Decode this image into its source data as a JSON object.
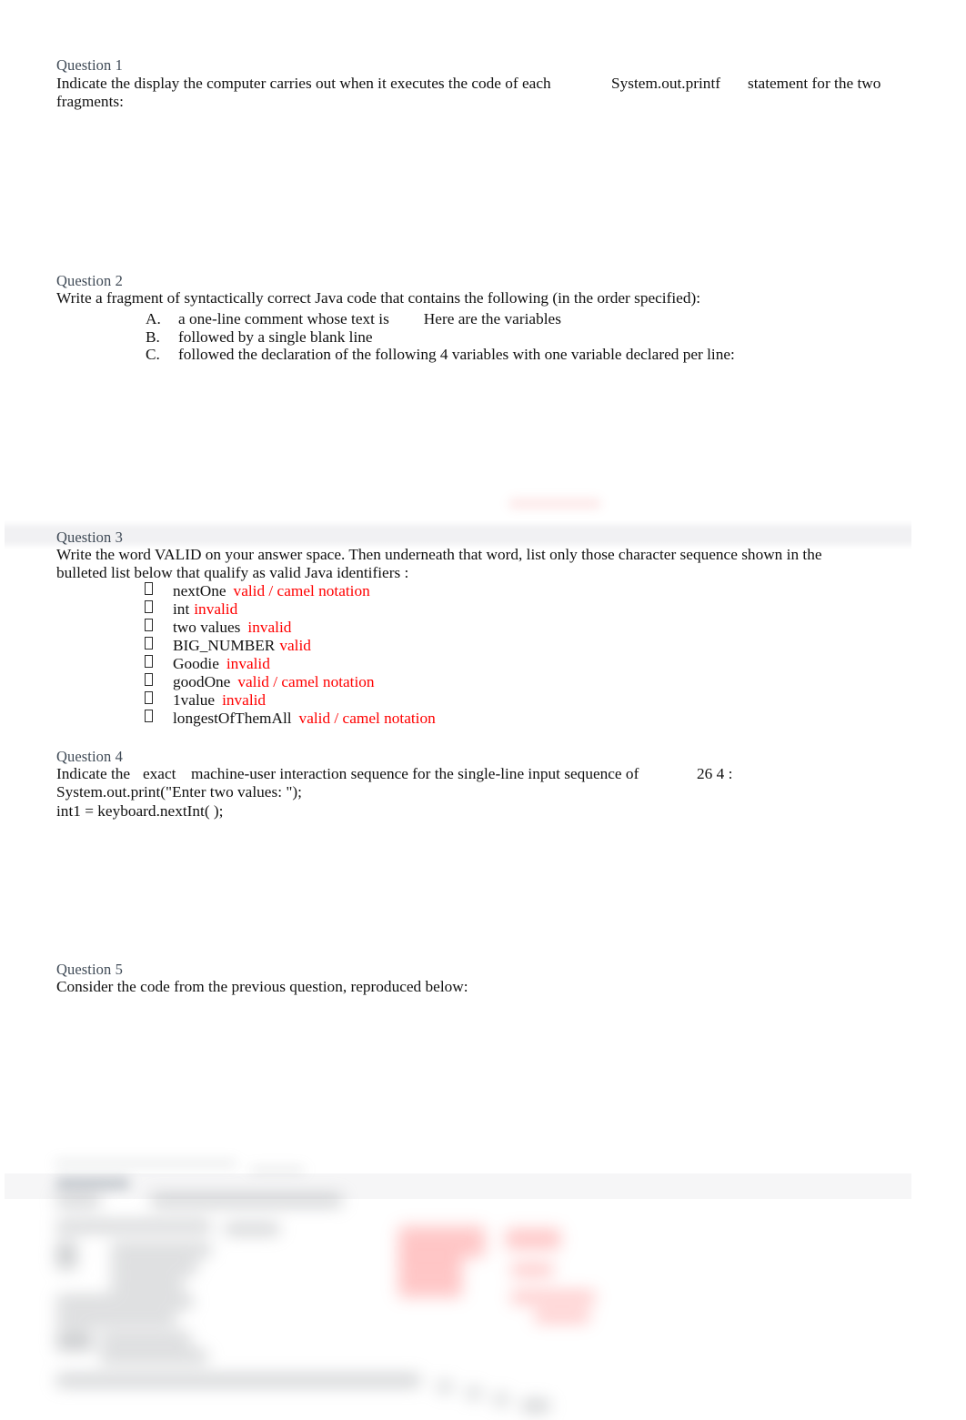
{
  "document": {
    "page_background": "#ffffff",
    "heading_color": "#3f4a56",
    "annotation_color": "#ff0000",
    "highlight_band_color": "#f1f1f3"
  },
  "questions": [
    {
      "heading": "Question 1",
      "body_line_1": "Indicate the display the computer carries out when it executes the code of each",
      "body_code": "System.out.printf",
      "body_line_2": "statement for the two",
      "body_line_3": "fragments:"
    },
    {
      "heading": "Question 2",
      "body_line_1": "Write a fragment of syntactically correct Java code that contains the following (in the order specified):",
      "items": [
        {
          "marker": "A.",
          "text": "a one-line comment whose text is",
          "emphasis": "Here are the variables"
        },
        {
          "marker": "B.",
          "text": "followed by a single blank line",
          "emphasis": ""
        },
        {
          "marker": "C.",
          "text": "followed the declaration of the following 4 variables with one variable declared per line:",
          "emphasis": ""
        }
      ]
    },
    {
      "heading": "Question 3",
      "body_line_1": "Write the word VALID on your answer space. Then underneath that word, list only those character sequence shown in the",
      "body_line_2": "bulleted list below that qualify as valid Java identifiers :",
      "bullet_glyph": "missing-glyph-box",
      "items": [
        {
          "term": "nextOne",
          "note": "valid / camel notation"
        },
        {
          "term": "int",
          "note": "invalid"
        },
        {
          "term": "two values",
          "note": "invalid"
        },
        {
          "term": "BIG_NUMBER",
          "note": "valid"
        },
        {
          "term": "Goodie",
          "note": "invalid"
        },
        {
          "term": "goodOne",
          "note": "valid / camel notation"
        },
        {
          "term": "1value",
          "note": "invalid"
        },
        {
          "term": "longestOfThemAll",
          "note": "valid / camel notation"
        }
      ]
    },
    {
      "heading": "Question 4",
      "body_line_1a": "Indicate the",
      "body_line_1b": "exact",
      "body_line_1c": "machine-user interaction sequence for the single-line input sequence of",
      "body_line_1d": "26 4  :",
      "body_line_2": "System.out.print(\"Enter two values: \");",
      "body_line_3": "int1 = keyboard.nextInt( );"
    },
    {
      "heading": "Question 5",
      "body_line_1": "Consider the code from the previous question, reproduced below:"
    }
  ],
  "obscured_region": {
    "label": "blurred-preview-content",
    "description": "Lower portion of page is blurred out and unreadable"
  }
}
